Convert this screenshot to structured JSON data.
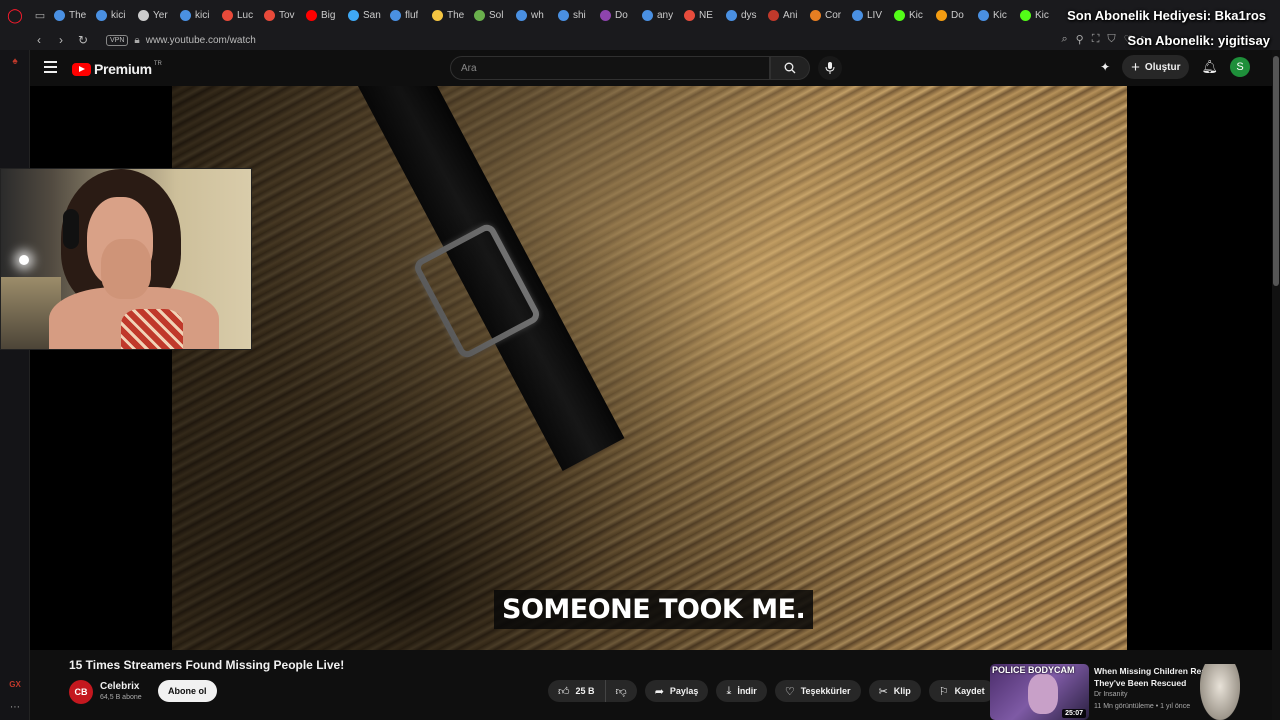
{
  "browser": {
    "tabs": [
      {
        "label": "The",
        "color": "#4a90e2"
      },
      {
        "label": "kici",
        "color": "#4a90e2"
      },
      {
        "label": "Yer",
        "color": "#cccccc"
      },
      {
        "label": "kici",
        "color": "#4a90e2"
      },
      {
        "label": "Luc",
        "color": "#e84a3a"
      },
      {
        "label": "Tov",
        "color": "#e84a3a"
      },
      {
        "label": "Big",
        "color": "#ff0000"
      },
      {
        "label": "San",
        "color": "#3fa9f5"
      },
      {
        "label": "fluf",
        "color": "#4a90e2"
      },
      {
        "label": "The",
        "color": "#f5c542"
      },
      {
        "label": "Sol",
        "color": "#6ab04c"
      },
      {
        "label": "wh",
        "color": "#4a90e2"
      },
      {
        "label": "shi",
        "color": "#4a90e2"
      },
      {
        "label": "Do",
        "color": "#8e44ad"
      },
      {
        "label": "any",
        "color": "#4a90e2"
      },
      {
        "label": "NE",
        "color": "#e74c3c"
      },
      {
        "label": "dys",
        "color": "#4a90e2"
      },
      {
        "label": "Ani",
        "color": "#c0392b"
      },
      {
        "label": "Cor",
        "color": "#e67e22"
      },
      {
        "label": "LIV",
        "color": "#4a90e2"
      },
      {
        "label": "Kic",
        "color": "#53fc18"
      },
      {
        "label": "Do",
        "color": "#f39c12"
      },
      {
        "label": "Kic",
        "color": "#4a90e2"
      },
      {
        "label": "Kic",
        "color": "#53fc18"
      }
    ],
    "active_tab_index": 6,
    "vpn_label": "VPN",
    "url": "www.youtube.com/watch"
  },
  "stream_overlay": {
    "line1": "Son Abonelik Hediyesi: Bka1ros",
    "line2": "Son Abonelik: yigitisay"
  },
  "youtube": {
    "logo_text": "Premium",
    "logo_region": "TR",
    "search_placeholder": "Ara",
    "create_label": "Oluştur",
    "avatar_letter": "S",
    "subtitle": "SOMEONE TOOK ME.",
    "video_title": "15 Times Streamers Found Missing People Live!",
    "channel": {
      "name": "Celebrix",
      "avatar_text": "CB",
      "subscribers": "64,5 B abone",
      "subscribe_label": "Abone ol"
    },
    "actions": {
      "likes": "25 B",
      "share": "Paylaş",
      "download": "İndir",
      "thanks": "Teşekkürler",
      "clip": "Klip",
      "save": "Kaydet"
    },
    "recommendation": {
      "title": "When Missing Children Realize They've Been Rescued",
      "channel": "Dr Insanity",
      "meta": "11 Mn görüntüleme • 1 yıl önce",
      "duration": "25:07",
      "thumb_text": "POLICE BODYCAM"
    }
  },
  "sidepanel": {
    "bottom_label": "GX"
  }
}
